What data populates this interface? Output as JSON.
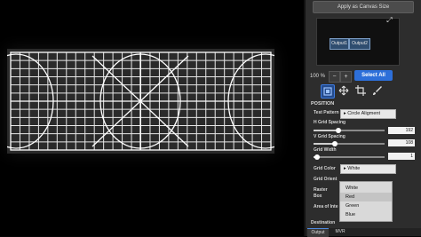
{
  "panel": {
    "apply_canvas_label": "Apply as Canvas Size",
    "preview": {
      "outputs": [
        "Output1",
        "Output2"
      ]
    },
    "zoom": {
      "value": "100 %",
      "minus": "−",
      "plus": "+"
    },
    "select_all_label": "Select All",
    "position_title": "POSITION",
    "test_pattern": {
      "label": "Test Pattern",
      "value": "Circle Aligment"
    },
    "h_spacing": {
      "label": "H Grid Spacing",
      "value": "192",
      "fraction": 0.35
    },
    "v_spacing": {
      "label": "V Grid Spacing",
      "value": "108",
      "fraction": 0.3
    },
    "grid_width": {
      "label": "Grid Width",
      "value": "1",
      "fraction": 0.05
    },
    "grid_color": {
      "label": "Grid Color",
      "value": "White"
    },
    "grid_orient": {
      "label": "Grid Orient"
    },
    "raster_box": {
      "label": "Raster Box"
    },
    "area_of_interest": {
      "label": "Area of Inte"
    },
    "color_menu": [
      "White",
      "Red",
      "Green",
      "Blue"
    ],
    "destination_label": "Destination",
    "tabs": [
      "Output",
      "MVR"
    ]
  },
  "colors": {
    "accent": "#2d6fd9",
    "panel_bg": "#2d2d2d",
    "grid_line": "#ffffff"
  }
}
